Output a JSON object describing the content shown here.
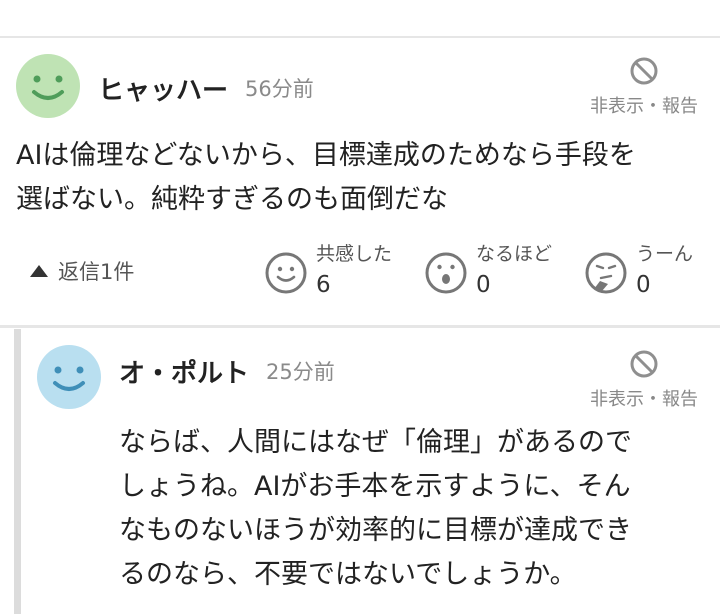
{
  "comments": [
    {
      "username": "ヒャッハー",
      "time": "56分前",
      "hide_report": "非表示・報告",
      "body_lines": [
        "AIは倫理などないから、目標達成のためなら手段を",
        "選ばない。純粋すぎるのも面倒だな"
      ],
      "reply_toggle": "返信1件",
      "reactions": [
        {
          "label": "共感した",
          "count": "6",
          "icon": "smile-face-icon"
        },
        {
          "label": "なるほど",
          "count": "0",
          "icon": "surprised-face-icon"
        },
        {
          "label": "うーん",
          "count": "0",
          "icon": "thinking-face-icon"
        }
      ],
      "avatar_color": "#bfe3b4"
    },
    {
      "username": "オ・ポルト",
      "time": "25分前",
      "hide_report": "非表示・報告",
      "body_lines": [
        "ならば、人間にはなぜ「倫理」があるので",
        "しょうね。AIがお手本を示すように、そん",
        "なものないほうが効率的に目標が達成でき",
        "るのなら、不要ではないでしょうか。"
      ],
      "avatar_color": "#b9dff0"
    }
  ]
}
